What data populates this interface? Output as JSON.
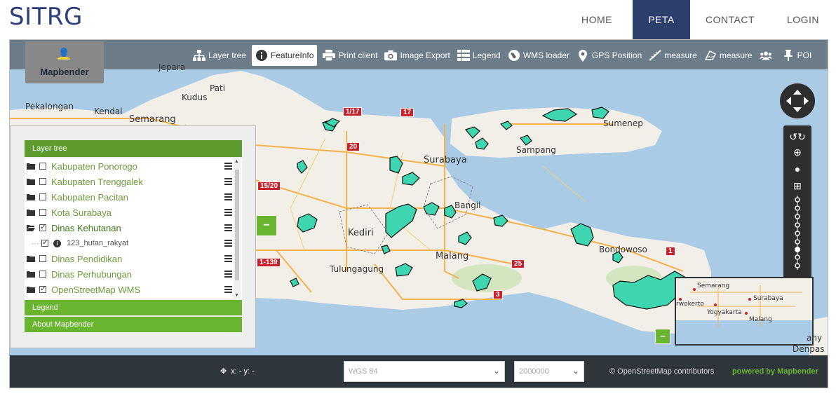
{
  "brand": "SITRG",
  "nav": [
    {
      "label": "HOME",
      "active": false
    },
    {
      "label": "PETA",
      "active": true
    },
    {
      "label": "CONTACT",
      "active": false
    },
    {
      "label": "LOGIN",
      "active": false
    }
  ],
  "logo_text": "Mapbender",
  "toolbar": {
    "layer_tree": "Layer tree",
    "feature_info": "FeatureInfo",
    "print_client": "Print client",
    "image_export": "Image Export",
    "legend": "Legend",
    "wms_loader": "WMS loader",
    "gps_position": "GPS Position",
    "measure_line": "measure",
    "measure_area": "measure",
    "poi": "POI"
  },
  "layer_panel": {
    "title": "Layer tree",
    "layers": [
      {
        "label": "Kabupaten Ponorogo",
        "checked": false
      },
      {
        "label": "Kabupaten Trenggalek",
        "checked": false
      },
      {
        "label": "Kabupaten Pacitan",
        "checked": false
      },
      {
        "label": "Kota Surabaya",
        "checked": false
      },
      {
        "label": "Dinas Kehutanan",
        "checked": true
      },
      {
        "label": "123_hutan_rakyat",
        "checked": true
      },
      {
        "label": "Dinas Pendidikan",
        "checked": false
      },
      {
        "label": "Dinas Perhubungan",
        "checked": false
      },
      {
        "label": "OpenStreetMap WMS",
        "checked": true
      }
    ],
    "legend_label": "Legend",
    "about_label": "About Mapbender"
  },
  "map_labels": {
    "jepara": "Jepara",
    "pati": "Pati",
    "kudus": "Kudus",
    "pekalongan": "Pekalongan",
    "kendal": "Kendal",
    "semarang": "Semarang",
    "surabaya": "Surabaya",
    "sumenep": "Sumenep",
    "sampang": "Sampang",
    "bangil": "Bangil",
    "kediri": "Kediri",
    "malang": "Malang",
    "tulungagung": "Tulungagung",
    "bondowoso": "Bondowoso",
    "shield_117": "1/17",
    "shield_17": "17",
    "shield_20": "20",
    "shield_1520": "15/20",
    "shield_139": "1-139",
    "shield_25": "25",
    "shield_3": "3",
    "shield_1": "1"
  },
  "overview_labels": {
    "semarang": "Semarang",
    "surabaya": "Surabaya",
    "purwokerto": "rwokerto",
    "yogyakarta": "Yogyakarta",
    "malang": "Malang",
    "denpasar": "Denpas",
    "bany": "any"
  },
  "footer": {
    "coords": "x: - y: -",
    "srs_value": "WGS 84",
    "scale_value": "2000000",
    "attribution": "© OpenStreetMap contributors",
    "powered": "powered by Mapbender"
  },
  "colors": {
    "nav_active": "#2c3e6b",
    "accent_green": "#6ab52f",
    "forest_fill": "#3dd6b0",
    "sea": "#a9cbe6",
    "land": "#f2efe9"
  }
}
